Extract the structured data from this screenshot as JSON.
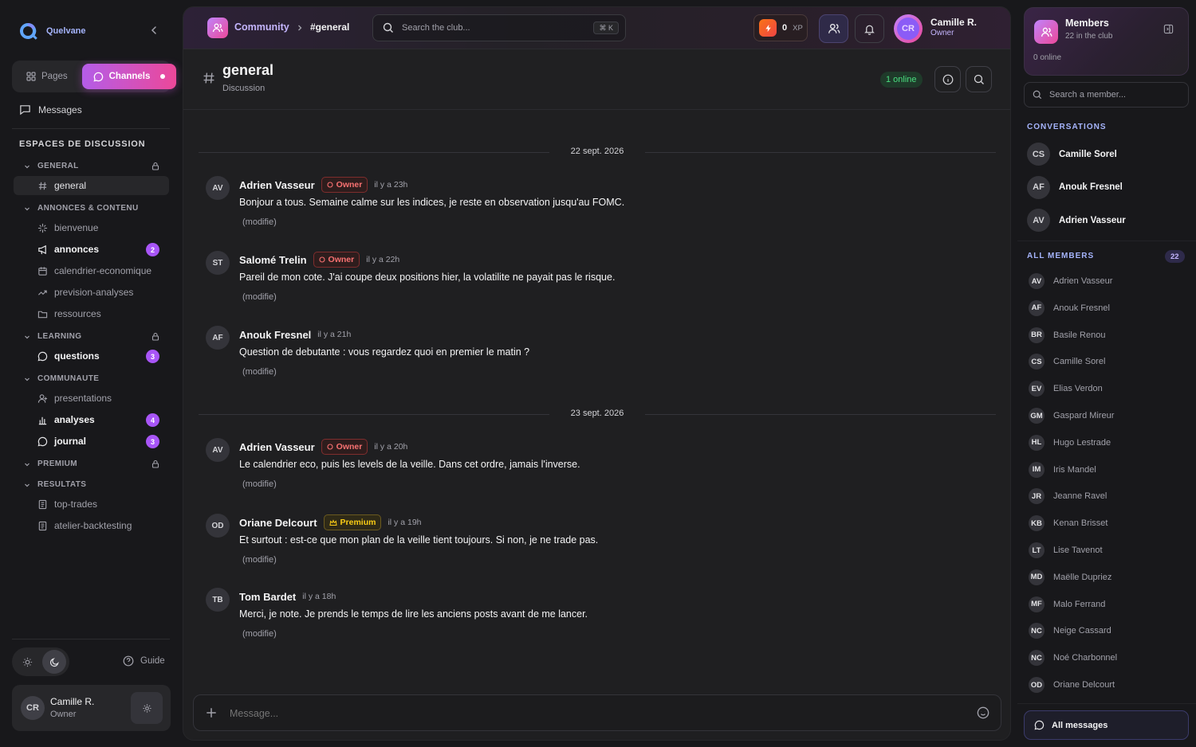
{
  "app": {
    "name": "Quelvane"
  },
  "sidebar": {
    "tabs": [
      {
        "label": "Pages"
      },
      {
        "label": "Channels"
      }
    ],
    "messages_label": "Messages",
    "section_title": "ESPACES DE DISCUSSION",
    "categories": [
      {
        "name": "GENERAL",
        "locked": true,
        "channels": [
          {
            "name": "general",
            "icon": "hash-icon",
            "active": true
          }
        ]
      },
      {
        "name": "ANNONCES & CONTENU",
        "locked": false,
        "channels": [
          {
            "name": "bienvenue",
            "icon": "sparkle-icon"
          },
          {
            "name": "annonces",
            "icon": "megaphone-icon",
            "badge": "2",
            "bold": true
          },
          {
            "name": "calendrier-economique",
            "icon": "calendar-icon"
          },
          {
            "name": "prevision-analyses",
            "icon": "trend-icon"
          },
          {
            "name": "ressources",
            "icon": "folder-icon"
          }
        ]
      },
      {
        "name": "LEARNING",
        "locked": true,
        "channels": [
          {
            "name": "questions",
            "icon": "chat-bubble-icon",
            "badge": "3",
            "bold": true
          }
        ]
      },
      {
        "name": "COMMUNAUTE",
        "locked": false,
        "channels": [
          {
            "name": "presentations",
            "icon": "user-plus-icon"
          },
          {
            "name": "analyses",
            "icon": "bar-chart-icon",
            "badge": "4",
            "bold": true
          },
          {
            "name": "journal",
            "icon": "chat-bubble-icon",
            "badge": "3",
            "bold": true
          }
        ]
      },
      {
        "name": "PREMIUM",
        "locked": true,
        "channels": []
      },
      {
        "name": "RESULTATS",
        "locked": false,
        "channels": [
          {
            "name": "top-trades",
            "icon": "notebook-icon"
          },
          {
            "name": "atelier-backtesting",
            "icon": "notebook-icon"
          }
        ]
      }
    ],
    "guide_label": "Guide",
    "user": {
      "initials": "CR",
      "name": "Camille R.",
      "role": "Owner"
    }
  },
  "topbar": {
    "breadcrumb": {
      "community": "Community",
      "channel": "#general"
    },
    "search_placeholder": "Search the club...",
    "search_shortcut": "⌘ K",
    "xp_value": "0",
    "xp_unit": "XP",
    "user": {
      "initials": "CR",
      "name": "Camille R.",
      "role": "Owner"
    }
  },
  "channel_header": {
    "title": "general",
    "subtitle": "Discussion",
    "online": "1 online"
  },
  "messages": {
    "days": [
      {
        "label": "22 sept. 2026",
        "items": [
          {
            "initials": "AV",
            "author": "Adrien Vasseur",
            "role": "Owner",
            "time": "il y a 23h",
            "text": "Bonjour a tous. Semaine calme sur les indices, je reste en observation jusqu'au FOMC.",
            "edited": "(modifie)"
          },
          {
            "initials": "ST",
            "author": "Salomé Trelin",
            "role": "Owner",
            "time": "il y a 22h",
            "text": "Pareil de mon cote. J'ai coupe deux positions hier, la volatilite ne payait pas le risque.",
            "edited": "(modifie)"
          },
          {
            "initials": "AF",
            "author": "Anouk Fresnel",
            "role": "",
            "time": "il y a 21h",
            "text": "Question de debutante : vous regardez quoi en premier le matin ?",
            "edited": "(modifie)"
          }
        ]
      },
      {
        "label": "23 sept. 2026",
        "items": [
          {
            "initials": "AV",
            "author": "Adrien Vasseur",
            "role": "Owner",
            "time": "il y a 20h",
            "text": "Le calendrier eco, puis les levels de la veille. Dans cet ordre, jamais l'inverse.",
            "edited": "(modifie)"
          },
          {
            "initials": "OD",
            "author": "Oriane Delcourt",
            "role": "Premium",
            "time": "il y a 19h",
            "text": "Et surtout : est-ce que mon plan de la veille tient toujours. Si non, je ne trade pas.",
            "edited": "(modifie)"
          },
          {
            "initials": "TB",
            "author": "Tom Bardet",
            "role": "",
            "time": "il y a 18h",
            "text": "Merci, je note. Je prends le temps de lire les anciens posts avant de me lancer.",
            "edited": "(modifie)"
          }
        ]
      }
    ]
  },
  "composer": {
    "placeholder": "Message..."
  },
  "right_panel": {
    "title": "Members",
    "subtitle": "22 in the club",
    "online": "0 online",
    "search_placeholder": "Search a member...",
    "conversations_title": "CONVERSATIONS",
    "conversations": [
      {
        "initials": "CS",
        "name": "Camille Sorel"
      },
      {
        "initials": "AF",
        "name": "Anouk Fresnel"
      },
      {
        "initials": "AV",
        "name": "Adrien Vasseur"
      }
    ],
    "members_title": "ALL MEMBERS",
    "members_count": "22",
    "members": [
      {
        "initials": "AV",
        "name": "Adrien Vasseur"
      },
      {
        "initials": "AF",
        "name": "Anouk Fresnel"
      },
      {
        "initials": "BR",
        "name": "Basile Renou"
      },
      {
        "initials": "CS",
        "name": "Camille Sorel"
      },
      {
        "initials": "EV",
        "name": "Elias Verdon"
      },
      {
        "initials": "GM",
        "name": "Gaspard Mireur"
      },
      {
        "initials": "HL",
        "name": "Hugo Lestrade"
      },
      {
        "initials": "IM",
        "name": "Iris Mandel"
      },
      {
        "initials": "JR",
        "name": "Jeanne Ravel"
      },
      {
        "initials": "KB",
        "name": "Kenan Brisset"
      },
      {
        "initials": "LT",
        "name": "Lise Tavenot"
      },
      {
        "initials": "MD",
        "name": "Maëlle Dupriez"
      },
      {
        "initials": "MF",
        "name": "Malo Ferrand"
      },
      {
        "initials": "NC",
        "name": "Neige Cassard"
      },
      {
        "initials": "NC",
        "name": "Noé Charbonnel"
      },
      {
        "initials": "OD",
        "name": "Oriane Delcourt"
      }
    ],
    "all_messages_label": "All messages"
  }
}
